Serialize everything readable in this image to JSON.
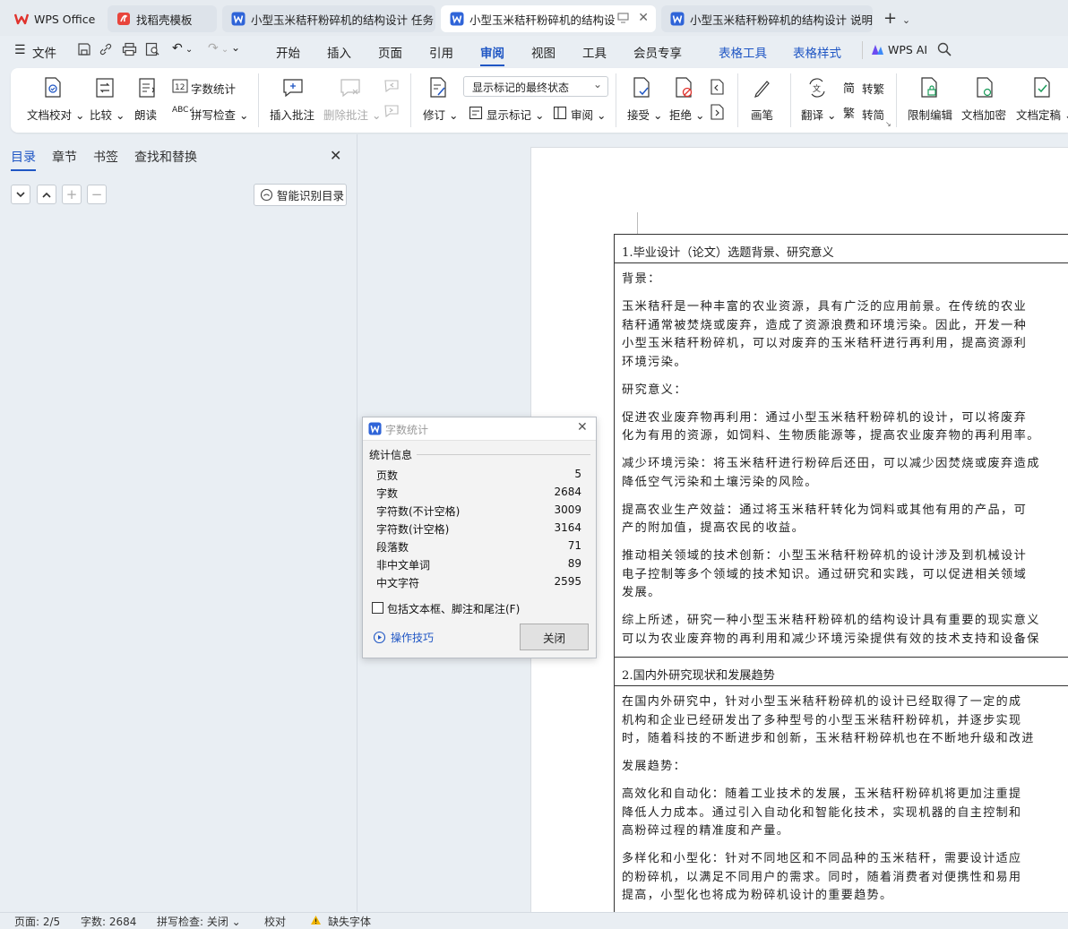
{
  "tabs": [
    {
      "label": "WPS Office"
    },
    {
      "label": "找稻壳模板"
    },
    {
      "label": "小型玉米秸秆粉碎机的结构设计 任务"
    },
    {
      "label": "小型玉米秸秆粉碎机的结构设"
    },
    {
      "label": "小型玉米秸秆粉碎机的结构设计 说明"
    }
  ],
  "menu": {
    "file": "文件",
    "items": [
      "开始",
      "插入",
      "页面",
      "引用",
      "审阅",
      "视图",
      "工具",
      "会员专享"
    ],
    "table_tools": "表格工具",
    "table_style": "表格样式",
    "wps_ai": "WPS AI",
    "active": "审阅"
  },
  "ribbon": {
    "proofread": "文档校对",
    "compare": "比较",
    "read_aloud": "朗读",
    "word_count": "字数统计",
    "spell_check": "拼写检查",
    "insert_comment": "插入批注",
    "delete_comment": "删除批注",
    "track_changes": "修订",
    "display_state": "显示标记的最终状态",
    "show_markup": "显示标记",
    "review": "审阅",
    "accept": "接受",
    "reject": "拒绝",
    "pen": "画笔",
    "translate": "翻译",
    "to_traditional": "转繁",
    "to_simplified": "转简",
    "restrict_edit": "限制编辑",
    "encrypt": "文档加密",
    "finalize": "文档定稿"
  },
  "nav": {
    "tabs": [
      "目录",
      "章节",
      "书签",
      "查找和替换"
    ],
    "active": "目录",
    "smart_toc": "智能识别目录"
  },
  "doc": {
    "h1": "1.毕业设计（论文）选题背景、研究意义",
    "sec1": [
      "背景：",
      "玉米秸秆是一种丰富的农业资源，具有广泛的应用前景。在传统的农业",
      "秸秆通常被焚烧或废弃，造成了资源浪费和环境污染。因此，开发一种",
      "小型玉米秸秆粉碎机，可以对废弃的玉米秸秆进行再利用，提高资源利",
      "环境污染。",
      "研究意义：",
      "促进农业废弃物再利用：通过小型玉米秸秆粉碎机的设计，可以将废弃",
      "化为有用的资源，如饲料、生物质能源等，提高农业废弃物的再利用率。",
      "减少环境污染：将玉米秸秆进行粉碎后还田，可以减少因焚烧或废弃造成",
      "降低空气污染和土壤污染的风险。",
      "提高农业生产效益：通过将玉米秸秆转化为饲料或其他有用的产品，可",
      "产的附加值，提高农民的收益。",
      "推动相关领域的技术创新：小型玉米秸秆粉碎机的设计涉及到机械设计",
      "电子控制等多个领域的技术知识。通过研究和实践，可以促进相关领域",
      "发展。",
      "综上所述，研究一种小型玉米秸秆粉碎机的结构设计具有重要的现实意义",
      "可以为农业废弃物的再利用和减少环境污染提供有效的技术支持和设备保"
    ],
    "h2": "2.国内外研究现状和发展趋势",
    "sec2": [
      "在国内外研究中，针对小型玉米秸秆粉碎机的设计已经取得了一定的成",
      "机构和企业已经研发出了多种型号的小型玉米秸秆粉碎机，并逐步实现",
      "时，随着科技的不断进步和创新，玉米秸秆粉碎机也在不断地升级和改进",
      "发展趋势：",
      "高效化和自动化：随着工业技术的发展，玉米秸秆粉碎机将更加注重提",
      "降低人力成本。通过引入自动化和智能化技术，实现机器的自主控制和",
      "高粉碎过程的精准度和产量。",
      "多样化和小型化：针对不同地区和不同品种的玉米秸秆，需要设计适应",
      "的粉碎机，以满足不同用户的需求。同时，随着消费者对便携性和易用",
      "提高，小型化也将成为粉碎机设计的重要趋势。"
    ]
  },
  "dialog": {
    "title": "字数统计",
    "section": "统计信息",
    "stats": [
      {
        "label": "页数",
        "value": "5"
      },
      {
        "label": "字数",
        "value": "2684"
      },
      {
        "label": "字符数(不计空格)",
        "value": "3009"
      },
      {
        "label": "字符数(计空格)",
        "value": "3164"
      },
      {
        "label": "段落数",
        "value": "71"
      },
      {
        "label": "非中文单词",
        "value": "89"
      },
      {
        "label": "中文字符",
        "value": "2595"
      }
    ],
    "include_label": "包括文本框、脚注和尾注(F)",
    "tips": "操作技巧",
    "close": "关闭"
  },
  "status": {
    "page": "页面: 2/5",
    "words": "字数: 2684",
    "spell": "拼写检查: 关闭",
    "proof": "校对",
    "missing_font": "缺失字体"
  },
  "colors": {
    "accent": "#1f56c4",
    "wps_red": "#e0332d",
    "docer_red": "#e8453c"
  }
}
